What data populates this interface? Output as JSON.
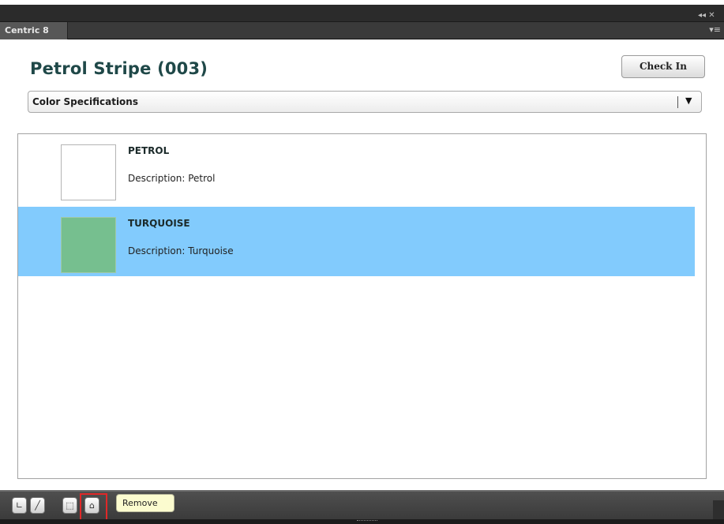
{
  "window": {
    "tab_label": "Centric 8",
    "frame_controls": "◂◂ ✕",
    "panel_menu_icon": "▾≡"
  },
  "header": {
    "title": "Petrol Stripe (003)",
    "check_in_label": "Check In"
  },
  "view_selector": {
    "selected": "Color Specifications",
    "arrow": "▼"
  },
  "colors": {
    "accent_title": "#1f4848",
    "selection": "#82cbfd",
    "turquoise_swatch": "#76bf8f",
    "petrol_swatch": "#ffffff"
  },
  "items": [
    {
      "name": "PETROL",
      "description": "Description: Petrol",
      "swatch_color": "#ffffff",
      "selected": false
    },
    {
      "name": "TURQUOISE",
      "description": "Description: Turquoise",
      "swatch_color": "#76bf8f",
      "selected": true
    }
  ],
  "toolbar": {
    "tools": [
      {
        "icon": "corner-icon",
        "glyph": "∟"
      },
      {
        "icon": "pencil-icon",
        "glyph": "╱"
      },
      {
        "icon": "add-palette-icon",
        "glyph": "⬚"
      },
      {
        "icon": "remove-icon",
        "glyph": "⌂"
      }
    ],
    "tooltip": "Remove"
  }
}
